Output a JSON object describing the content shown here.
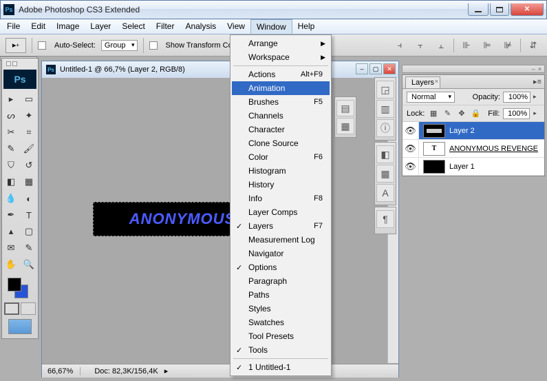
{
  "titlebar": {
    "app_name": "Adobe Photoshop CS3 Extended"
  },
  "menubar": [
    "File",
    "Edit",
    "Image",
    "Layer",
    "Select",
    "Filter",
    "Analysis",
    "View",
    "Window",
    "Help"
  ],
  "menubar_open_index": 8,
  "optionsbar": {
    "auto_select": "Auto-Select:",
    "group": "Group",
    "show_transform": "Show Transform Controls"
  },
  "window_menu": {
    "top": [
      {
        "label": "Arrange",
        "submenu": true
      },
      {
        "label": "Workspace",
        "submenu": true
      }
    ],
    "mid": [
      {
        "label": "Actions",
        "shortcut": "Alt+F9"
      },
      {
        "label": "Animation",
        "highlight": true
      },
      {
        "label": "Brushes",
        "shortcut": "F5"
      },
      {
        "label": "Channels"
      },
      {
        "label": "Character"
      },
      {
        "label": "Clone Source"
      },
      {
        "label": "Color",
        "shortcut": "F6"
      },
      {
        "label": "Histogram"
      },
      {
        "label": "History"
      },
      {
        "label": "Info",
        "shortcut": "F8"
      },
      {
        "label": "Layer Comps"
      },
      {
        "label": "Layers",
        "shortcut": "F7",
        "checked": true
      },
      {
        "label": "Measurement Log"
      },
      {
        "label": "Navigator"
      },
      {
        "label": "Options",
        "checked": true
      },
      {
        "label": "Paragraph"
      },
      {
        "label": "Paths"
      },
      {
        "label": "Styles"
      },
      {
        "label": "Swatches"
      },
      {
        "label": "Tool Presets"
      },
      {
        "label": "Tools",
        "checked": true
      }
    ],
    "bottom": [
      {
        "label": "1 Untitled-1",
        "checked": true
      }
    ]
  },
  "document": {
    "title": "Untitled-1 @ 66,7% (Layer 2, RGB/8)",
    "zoom": "66,67%",
    "docinfo_label": "Doc:",
    "docinfo": "82,3K/156,4K",
    "canvas_text": "ANONYMOUS"
  },
  "layers_panel": {
    "tab": "Layers",
    "blend_mode": "Normal",
    "opacity_label": "Opacity:",
    "opacity": "100%",
    "lock_label": "Lock:",
    "fill_label": "Fill:",
    "fill": "100%",
    "layers": [
      {
        "name": "Layer 2",
        "selected": true,
        "thumb": "bar"
      },
      {
        "name": "ANONYMOUS REVENGE",
        "type": "text",
        "underline": true
      },
      {
        "name": "Layer 1",
        "thumb": "black"
      }
    ]
  }
}
